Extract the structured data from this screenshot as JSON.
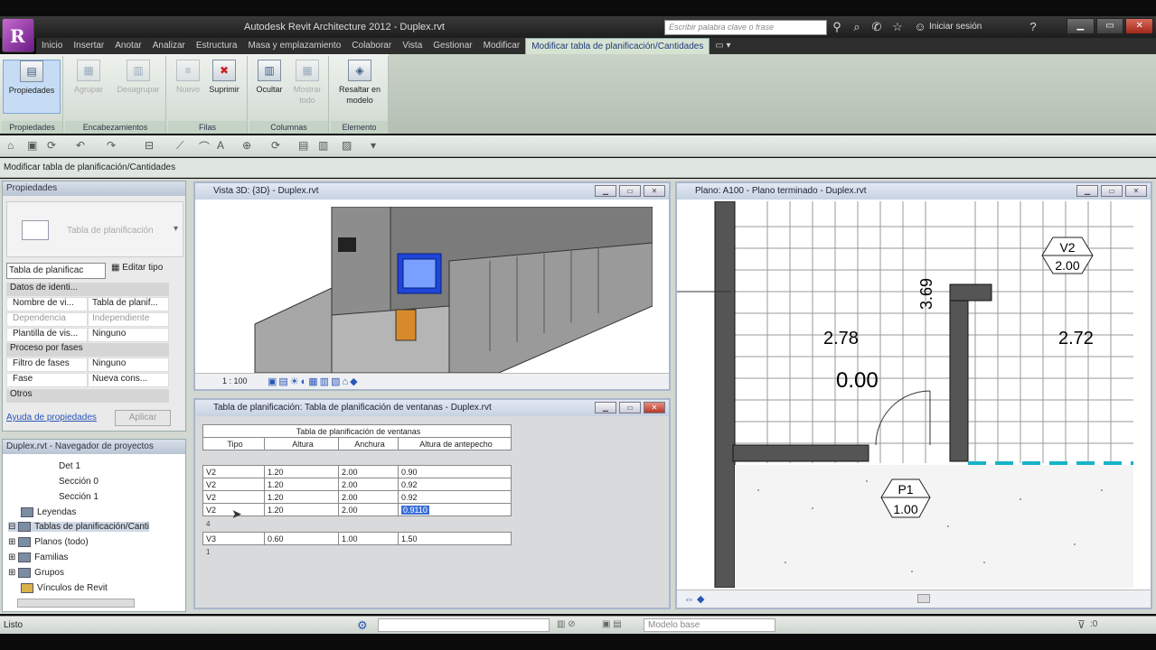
{
  "app": {
    "title": "Autodesk Revit Architecture 2012 -    Duplex.rvt",
    "logo_letter": "R"
  },
  "search": {
    "placeholder": "Escribir palabra clave o frase"
  },
  "signin": "Iniciar sesión",
  "tabs": [
    "Inicio",
    "Insertar",
    "Anotar",
    "Analizar",
    "Estructura",
    "Masa y emplazamiento",
    "Colaborar",
    "Vista",
    "Gestionar",
    "Modificar",
    "Modificar tabla de planificación/Cantidades"
  ],
  "ribbon": {
    "groups": [
      {
        "label": "Propiedades",
        "buttons": [
          "Propiedades"
        ]
      },
      {
        "label": "Encabezamientos",
        "buttons": [
          "Agrupar",
          "Desagrupar"
        ]
      },
      {
        "label": "Filas",
        "buttons": [
          "Nuevo",
          "Suprimir"
        ]
      },
      {
        "label": "Columnas",
        "buttons": [
          "Ocultar",
          "Mostrar todo"
        ]
      },
      {
        "label": "Elemento",
        "buttons": [
          "Resaltar en modelo"
        ]
      }
    ]
  },
  "context_bar": "Modificar tabla de planificación/Cantidades",
  "properties": {
    "title": "Propiedades",
    "type_name": "Tabla de planificación",
    "type_selector": "Tabla de planificac",
    "edit_type": "Editar tipo",
    "sections": [
      {
        "name": "Datos de identi...",
        "rows": [
          [
            "Nombre de vi...",
            "Tabla de planif..."
          ],
          [
            "Dependencia",
            "Independiente"
          ],
          [
            "Plantilla de vis...",
            "Ninguno"
          ]
        ]
      },
      {
        "name": "Proceso por fases",
        "rows": [
          [
            "Filtro de fases",
            "Ninguno"
          ],
          [
            "Fase",
            "Nueva cons..."
          ]
        ]
      },
      {
        "name": "Otros",
        "rows": []
      }
    ],
    "help_link": "Ayuda de propiedades",
    "apply": "Aplicar"
  },
  "project_browser": {
    "title": "Duplex.rvt - Navegador de proyectos",
    "items": [
      "Det 1",
      "Sección  0",
      "Sección  1",
      "Leyendas",
      "Tablas de planificación/Canti",
      "Planos (todo)",
      "Familias",
      "Grupos",
      "Vínculos de Revit"
    ]
  },
  "view3d": {
    "title": "Vista 3D: {3D} - Duplex.rvt",
    "scale": "1 : 100"
  },
  "viewplan": {
    "title": "Plano: A100 - Plano terminado - Duplex.rvt",
    "labels": {
      "tag_v2_top": "V2",
      "tag_v2_bottom": "2.00",
      "dim_278": "2.78",
      "dim_272": "2.72",
      "dim_000": "0.00",
      "dim_369": "3.69",
      "tag_p1_top": "P1",
      "tag_p1_bottom": "1.00"
    }
  },
  "schedule": {
    "title": "Tabla de planificación: Tabla de planificación de ventanas - Duplex.rvt",
    "table_title": "Tabla de planificación de ventanas",
    "headers": [
      "Tipo",
      "Altura",
      "Anchura",
      "Altura de antepecho"
    ],
    "group1": [
      [
        "V2",
        "1.20",
        "2.00",
        "0.90"
      ],
      [
        "V2",
        "1.20",
        "2.00",
        "0.92"
      ],
      [
        "V2",
        "1.20",
        "2.00",
        "0.92"
      ],
      [
        "V2",
        "1.20",
        "2.00",
        "0.9110"
      ]
    ],
    "group1_count": "4",
    "group2": [
      [
        "V3",
        "0.60",
        "1.00",
        "1.50"
      ]
    ],
    "group2_count": "1"
  },
  "status": {
    "text": "Listo",
    "model": "Modelo base",
    "zero": ":0"
  }
}
